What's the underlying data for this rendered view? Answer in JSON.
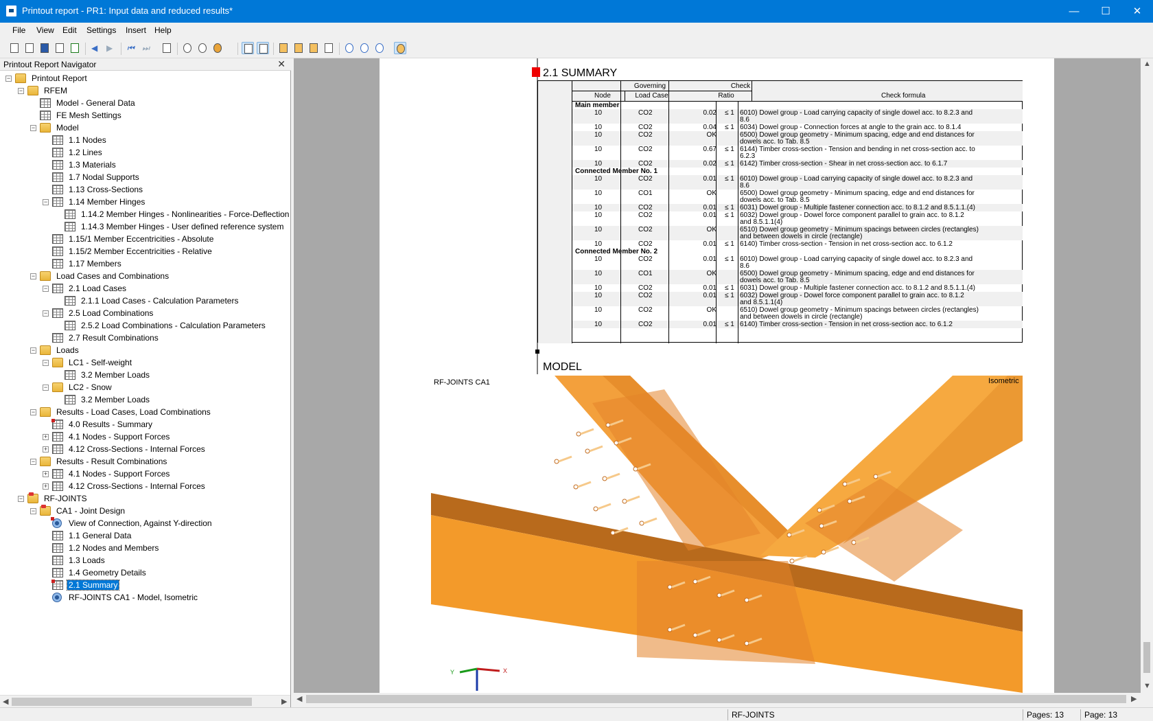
{
  "window": {
    "title": "Printout report - PR1: Input data and reduced results*",
    "controls": {
      "minimize": "—",
      "maximize": "☐",
      "close": "✕"
    }
  },
  "menu": [
    "File",
    "View",
    "Edit",
    "Settings",
    "Insert",
    "Help"
  ],
  "navigator": {
    "title": "Printout Report Navigator",
    "close": "✕",
    "items": [
      {
        "label": "Printout Report",
        "level": 0,
        "icon": "folder",
        "exp": "-"
      },
      {
        "label": "RFEM",
        "level": 1,
        "icon": "folder",
        "exp": "-"
      },
      {
        "label": "Model - General Data",
        "level": 2,
        "icon": "table",
        "exp": ""
      },
      {
        "label": "FE Mesh Settings",
        "level": 2,
        "icon": "table",
        "exp": ""
      },
      {
        "label": "Model",
        "level": 2,
        "icon": "folder",
        "exp": "-"
      },
      {
        "label": "1.1 Nodes",
        "level": 3,
        "icon": "table",
        "exp": ""
      },
      {
        "label": "1.2 Lines",
        "level": 3,
        "icon": "table",
        "exp": ""
      },
      {
        "label": "1.3 Materials",
        "level": 3,
        "icon": "table",
        "exp": ""
      },
      {
        "label": "1.7 Nodal Supports",
        "level": 3,
        "icon": "table",
        "exp": ""
      },
      {
        "label": "1.13 Cross-Sections",
        "level": 3,
        "icon": "table",
        "exp": ""
      },
      {
        "label": "1.14 Member Hinges",
        "level": 3,
        "icon": "table",
        "exp": "-"
      },
      {
        "label": "1.14.2 Member Hinges - Nonlinearities - Force-Deflection",
        "level": 4,
        "icon": "table",
        "exp": ""
      },
      {
        "label": "1.14.3 Member Hinges - User defined reference system",
        "level": 4,
        "icon": "table",
        "exp": ""
      },
      {
        "label": "1.15/1 Member Eccentricities - Absolute",
        "level": 3,
        "icon": "table",
        "exp": ""
      },
      {
        "label": "1.15/2 Member Eccentricities - Relative",
        "level": 3,
        "icon": "table",
        "exp": ""
      },
      {
        "label": "1.17 Members",
        "level": 3,
        "icon": "table",
        "exp": ""
      },
      {
        "label": "Load Cases and Combinations",
        "level": 2,
        "icon": "folder",
        "exp": "-"
      },
      {
        "label": "2.1 Load Cases",
        "level": 3,
        "icon": "table",
        "exp": "-"
      },
      {
        "label": "2.1.1 Load Cases - Calculation Parameters",
        "level": 4,
        "icon": "table",
        "exp": ""
      },
      {
        "label": "2.5 Load Combinations",
        "level": 3,
        "icon": "table",
        "exp": "-"
      },
      {
        "label": "2.5.2 Load Combinations - Calculation Parameters",
        "level": 4,
        "icon": "table",
        "exp": ""
      },
      {
        "label": "2.7 Result Combinations",
        "level": 3,
        "icon": "table",
        "exp": ""
      },
      {
        "label": "Loads",
        "level": 2,
        "icon": "folder",
        "exp": "-"
      },
      {
        "label": "LC1 - Self-weight",
        "level": 3,
        "icon": "folder",
        "exp": "-"
      },
      {
        "label": "3.2 Member Loads",
        "level": 4,
        "icon": "table",
        "exp": ""
      },
      {
        "label": "LC2 - Snow",
        "level": 3,
        "icon": "folder",
        "exp": "-"
      },
      {
        "label": "3.2 Member Loads",
        "level": 4,
        "icon": "table",
        "exp": ""
      },
      {
        "label": "Results - Load Cases, Load Combinations",
        "level": 2,
        "icon": "folder",
        "exp": "-"
      },
      {
        "label": "4.0 Results - Summary",
        "level": 3,
        "icon": "table-red",
        "exp": ""
      },
      {
        "label": "4.1 Nodes - Support Forces",
        "level": 3,
        "icon": "table",
        "exp": "+"
      },
      {
        "label": "4.12 Cross-Sections - Internal Forces",
        "level": 3,
        "icon": "table",
        "exp": "+"
      },
      {
        "label": "Results - Result Combinations",
        "level": 2,
        "icon": "folder",
        "exp": "-"
      },
      {
        "label": "4.1 Nodes - Support Forces",
        "level": 3,
        "icon": "table",
        "exp": "+"
      },
      {
        "label": "4.12 Cross-Sections - Internal Forces",
        "level": 3,
        "icon": "table",
        "exp": "+"
      },
      {
        "label": "RF-JOINTS",
        "level": 1,
        "icon": "folder-red",
        "exp": "-"
      },
      {
        "label": "CA1 - Joint Design",
        "level": 2,
        "icon": "folder-red",
        "exp": "-"
      },
      {
        "label": "View of Connection, Against Y-direction",
        "level": 3,
        "icon": "view-red",
        "exp": ""
      },
      {
        "label": "1.1 General Data",
        "level": 3,
        "icon": "table",
        "exp": ""
      },
      {
        "label": "1.2 Nodes and Members",
        "level": 3,
        "icon": "table",
        "exp": ""
      },
      {
        "label": "1.3 Loads",
        "level": 3,
        "icon": "table",
        "exp": ""
      },
      {
        "label": "1.4 Geometry Details",
        "level": 3,
        "icon": "table",
        "exp": ""
      },
      {
        "label": "2.1 Summary",
        "level": 3,
        "icon": "table-red",
        "exp": "",
        "selected": true
      },
      {
        "label": "RF-JOINTS CA1 - Model, Isometric",
        "level": 3,
        "icon": "view",
        "exp": ""
      }
    ]
  },
  "summary": {
    "heading": "2.1 SUMMARY",
    "header": {
      "governing": "Governing",
      "check": "Check",
      "node": "Node",
      "load_case": "Load Case",
      "ratio": "Ratio",
      "formula": "Check formula"
    },
    "rows": [
      {
        "type": "group",
        "label": "Main member"
      },
      {
        "node": "10",
        "lc": "CO2",
        "ratio": "0.02",
        "le": "≤ 1",
        "f1": "6010) Dowel group - Load carrying capacity of single dowel acc. to 8.2.3 and",
        "f2": "8.6"
      },
      {
        "node": "10",
        "lc": "CO2",
        "ratio": "0.04",
        "le": "≤ 1",
        "f1": "6034) Dowel group - Connection forces at angle to the grain acc. to 8.1.4",
        "f2": ""
      },
      {
        "node": "10",
        "lc": "CO2",
        "ratio": "OK",
        "le": "",
        "f1": "6500) Dowel group geometry - Minimum spacing, edge and end distances for",
        "f2": "dowels acc. to Tab. 8.5"
      },
      {
        "node": "10",
        "lc": "CO2",
        "ratio": "0.67",
        "le": "≤ 1",
        "f1": "6144) Timber cross-section - Tension and bending in net cross-section acc. to",
        "f2": "6.2.3"
      },
      {
        "node": "10",
        "lc": "CO2",
        "ratio": "0.02",
        "le": "≤ 1",
        "f1": "6142) Timber cross-section - Shear in net cross-section acc. to 6.1.7",
        "f2": ""
      },
      {
        "type": "group",
        "label": "Connected Member No. 1"
      },
      {
        "node": "10",
        "lc": "CO2",
        "ratio": "0.01",
        "le": "≤ 1",
        "f1": "6010) Dowel group - Load carrying capacity of single dowel acc. to 8.2.3 and",
        "f2": "8.6"
      },
      {
        "node": "10",
        "lc": "CO1",
        "ratio": "OK",
        "le": "",
        "f1": "6500) Dowel group geometry - Minimum spacing, edge and end distances for",
        "f2": "dowels acc. to Tab. 8.5"
      },
      {
        "node": "10",
        "lc": "CO2",
        "ratio": "0.01",
        "le": "≤ 1",
        "f1": "6031) Dowel group - Multiple fastener connection acc. to 8.1.2 and 8.5.1.1.(4)",
        "f2": ""
      },
      {
        "node": "10",
        "lc": "CO2",
        "ratio": "0.01",
        "le": "≤ 1",
        "f1": "6032) Dowel group - Dowel force component parallel to grain acc. to 8.1.2",
        "f2": "and 8.5.1.1(4)"
      },
      {
        "node": "10",
        "lc": "CO2",
        "ratio": "OK",
        "le": "",
        "f1": "6510) Dowel group geometry - Minimum spacings between circles (rectangles)",
        "f2": "and between dowels in circle (rectangle)"
      },
      {
        "node": "10",
        "lc": "CO2",
        "ratio": "0.01",
        "le": "≤ 1",
        "f1": "6140) Timber cross-section - Tension in net cross-section acc. to 6.1.2",
        "f2": ""
      },
      {
        "type": "group",
        "label": "Connected Member No. 2"
      },
      {
        "node": "10",
        "lc": "CO2",
        "ratio": "0.01",
        "le": "≤ 1",
        "f1": "6010) Dowel group - Load carrying capacity of single dowel acc. to 8.2.3 and",
        "f2": "8.6"
      },
      {
        "node": "10",
        "lc": "CO1",
        "ratio": "OK",
        "le": "",
        "f1": "6500) Dowel group geometry - Minimum spacing, edge and end distances for",
        "f2": "dowels acc. to Tab. 8.5"
      },
      {
        "node": "10",
        "lc": "CO2",
        "ratio": "0.01",
        "le": "≤ 1",
        "f1": "6031) Dowel group - Multiple fastener connection acc. to 8.1.2 and 8.5.1.1.(4)",
        "f2": ""
      },
      {
        "node": "10",
        "lc": "CO2",
        "ratio": "0.01",
        "le": "≤ 1",
        "f1": "6032) Dowel group - Dowel force component parallel to grain acc. to 8.1.2",
        "f2": "and 8.5.1.1(4)"
      },
      {
        "node": "10",
        "lc": "CO2",
        "ratio": "OK",
        "le": "",
        "f1": "6510) Dowel group geometry - Minimum spacings between circles (rectangles)",
        "f2": "and between dowels in circle (rectangle)"
      },
      {
        "node": "10",
        "lc": "CO2",
        "ratio": "0.01",
        "le": "≤ 1",
        "f1": "6140) Timber cross-section - Tension in net cross-section acc. to 6.1.2",
        "f2": ""
      }
    ]
  },
  "model": {
    "heading": "MODEL",
    "title_left": "RF-JOINTS CA1",
    "title_right": "Isometric",
    "axis_y": "Y",
    "axis_x": "X",
    "timber_color": "#f39a2a",
    "plate_color": "#e4842a"
  },
  "status": {
    "module": "RF-JOINTS",
    "pages": "Pages: 13",
    "page": "Page: 13"
  }
}
